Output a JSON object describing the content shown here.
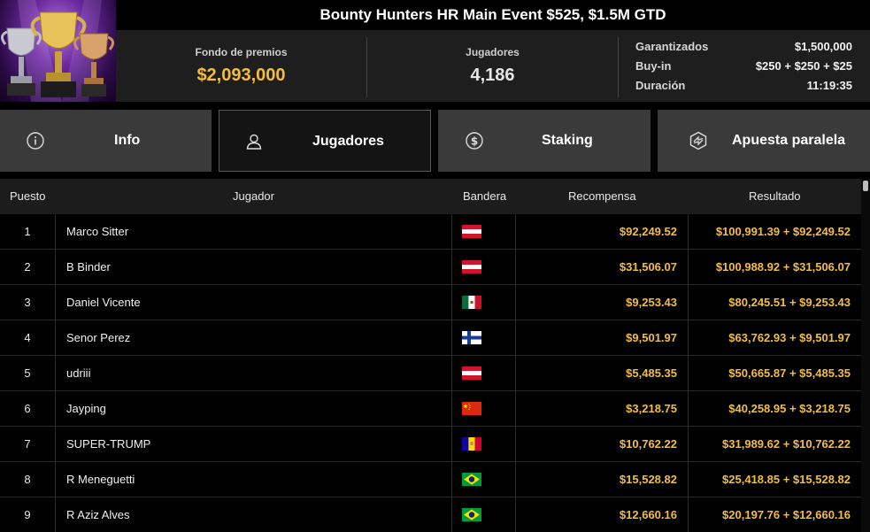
{
  "header": {
    "title": "Bounty Hunters HR Main Event $525, $1.5M GTD",
    "prize_pool_label": "Fondo de premios",
    "prize_pool_value": "$2,093,000",
    "players_label": "Jugadores",
    "players_value": "4,186",
    "details": [
      {
        "key": "Garantizados",
        "value": "$1,500,000"
      },
      {
        "key": "Buy-in",
        "value": "$250 + $250 + $25"
      },
      {
        "key": "Duración",
        "value": "11:19:35"
      }
    ]
  },
  "tabs": [
    {
      "label": "Info",
      "icon": "info-icon",
      "active": false
    },
    {
      "label": "Jugadores",
      "icon": "user-icon",
      "active": true
    },
    {
      "label": "Staking",
      "icon": "dollar-coin-icon",
      "active": false
    },
    {
      "label": "Apuesta paralela",
      "icon": "hexagon-bolt-icon",
      "active": false
    }
  ],
  "table": {
    "headers": {
      "position": "Puesto",
      "player": "Jugador",
      "flag": "Bandera",
      "reward": "Recompensa",
      "result": "Resultado"
    },
    "rows": [
      {
        "position": "1",
        "player": "Marco Sitter",
        "flag": "austria-flag",
        "reward": "$92,249.52",
        "result": "$100,991.39 + $92,249.52"
      },
      {
        "position": "2",
        "player": "B Binder",
        "flag": "austria-flag",
        "reward": "$31,506.07",
        "result": "$100,988.92 + $31,506.07"
      },
      {
        "position": "3",
        "player": "Daniel Vicente",
        "flag": "mexico-flag",
        "reward": "$9,253.43",
        "result": "$80,245.51 + $9,253.43"
      },
      {
        "position": "4",
        "player": "Senor Perez",
        "flag": "finland-flag",
        "reward": "$9,501.97",
        "result": "$63,762.93 + $9,501.97"
      },
      {
        "position": "5",
        "player": "udriii",
        "flag": "austria-flag",
        "reward": "$5,485.35",
        "result": "$50,665.87 + $5,485.35"
      },
      {
        "position": "6",
        "player": "Jayping",
        "flag": "china-flag",
        "reward": "$3,218.75",
        "result": "$40,258.95 + $3,218.75"
      },
      {
        "position": "7",
        "player": "SUPER-TRUMP",
        "flag": "andorra-flag",
        "reward": "$10,762.22",
        "result": "$31,989.62 + $10,762.22"
      },
      {
        "position": "8",
        "player": "R Meneguetti",
        "flag": "brazil-flag",
        "reward": "$15,528.82",
        "result": "$25,418.85 + $15,528.82"
      },
      {
        "position": "9",
        "player": "R Aziz Alves",
        "flag": "brazil-flag",
        "reward": "$12,660.16",
        "result": "$20,197.76 + $12,660.16"
      }
    ]
  },
  "colors": {
    "accent_gold": "#f5bd3c",
    "tab_bg": "#3a3a3a",
    "tab_active_bg": "#141414",
    "header_bar_bg": "#1e1e1e"
  }
}
